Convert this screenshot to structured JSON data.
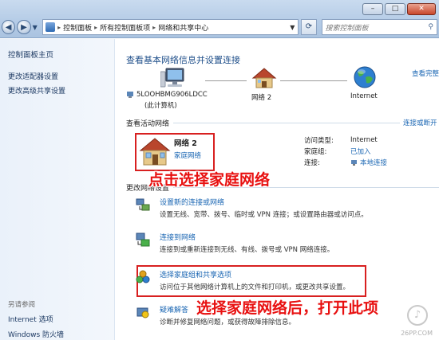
{
  "window": {
    "minimize": "–",
    "maximize": "□",
    "close": "✕"
  },
  "address": {
    "crumbs": [
      "控制面板",
      "所有控制面板项",
      "网络和共享中心"
    ],
    "search_placeholder": "搜索控制面板"
  },
  "sidebar": {
    "home": "控制面板主页",
    "links": [
      "更改适配器设置",
      "更改高级共享设置"
    ],
    "see_also_title": "另请参阅",
    "see_also": [
      "Internet 选项",
      "Windows 防火墙"
    ]
  },
  "main": {
    "heading": "查看基本网络信息并设置连接",
    "see_full_map": "查看完整",
    "map": {
      "computer": "5LOOHBMG906LDCC",
      "computer_sub": "(此计算机)",
      "network": "网络  2",
      "internet": "Internet"
    },
    "active_label": "查看活动网络",
    "connect_link": "连接或断开",
    "network": {
      "name": "网络  2",
      "type": "家庭网络"
    },
    "props": [
      {
        "k": "访问类型:",
        "v": "Internet",
        "link": false
      },
      {
        "k": "家庭组:",
        "v": "已加入",
        "link": true
      },
      {
        "k": "连接:",
        "v": "本地连接",
        "link": true
      }
    ],
    "change_label": "更改网络设置",
    "tasks": [
      {
        "title": "设置新的连接或网络",
        "desc": "设置无线、宽带、拨号、临时或 VPN 连接；或设置路由器或访问点。"
      },
      {
        "title": "连接到网络",
        "desc": "连接到或重新连接到无线、有线、拨号或 VPN 网络连接。"
      },
      {
        "title": "选择家庭组和共享选项",
        "desc": "访问位于其他网络计算机上的文件和打印机，或更改共享设置。"
      },
      {
        "title": "疑难解答",
        "desc": "诊断并修复网络问题，或获得故障排除信息。"
      }
    ]
  },
  "annotations": {
    "click_note": "点击选择家庭网络",
    "open_note": "选择家庭网络后，打开此项"
  },
  "watermark": "26PP.COM",
  "colors": {
    "link": "#1a66b3",
    "heading": "#1f4f8a",
    "highlight": "#d82020"
  }
}
